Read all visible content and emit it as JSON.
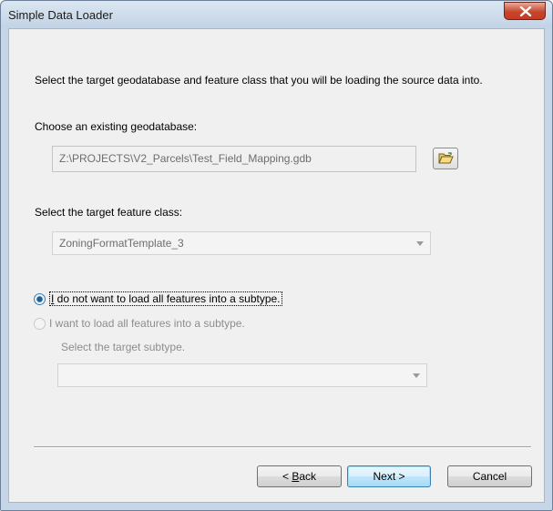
{
  "window": {
    "title": "Simple Data Loader"
  },
  "description": "Select the target geodatabase and feature class that you will be loading the source data into.",
  "geodatabase": {
    "label": "Choose an existing geodatabase:",
    "value": "Z:\\PROJECTS\\V2_Parcels\\Test_Field_Mapping.gdb",
    "browse_icon": "open-folder-icon"
  },
  "feature_class": {
    "label": "Select the target feature class:",
    "selected": "ZoningFormatTemplate_3"
  },
  "subtype_options": {
    "option_no_subtype": {
      "first_letter": "I",
      "rest": " do not want to load all features into a subtype.",
      "selected": true
    },
    "option_subtype": {
      "label": "I want to load all features into a subtype.",
      "selected": false
    },
    "subtype_label": "Select the target subtype.",
    "subtype_selected": ""
  },
  "buttons": {
    "back_prefix": "< ",
    "back_accel": "B",
    "back_rest": "ack",
    "next": "Next >",
    "cancel": "Cancel"
  },
  "colors": {
    "frame": "#c7d6e6",
    "close": "#c6472d",
    "face": "#f0f0f0",
    "accent": "#3c7fb1"
  }
}
